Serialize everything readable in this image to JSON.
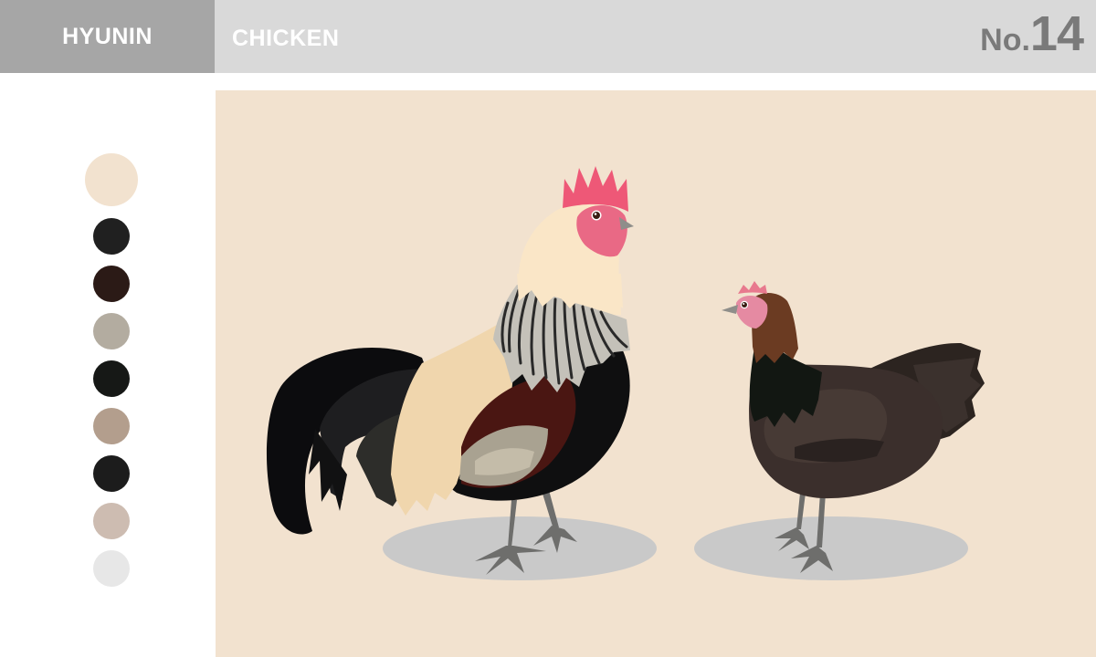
{
  "header": {
    "brand": "HYUNIN",
    "title": "CHICKEN",
    "number_prefix": "No.",
    "number": "14"
  },
  "colors": {
    "header_bar": "#d9d9d9",
    "brand_box": "#a6a6a6",
    "canvas_bg": "#f2e2cf",
    "shadow": "#c9c9c9"
  },
  "palette": [
    "#f2e2cf",
    "#202020",
    "#2b1a16",
    "#b3aca0",
    "#161816",
    "#b39e8d",
    "#1c1c1c",
    "#cdbcb1",
    "#e7e7e7"
  ],
  "illustration": {
    "subjects": [
      "rooster",
      "hen"
    ]
  }
}
